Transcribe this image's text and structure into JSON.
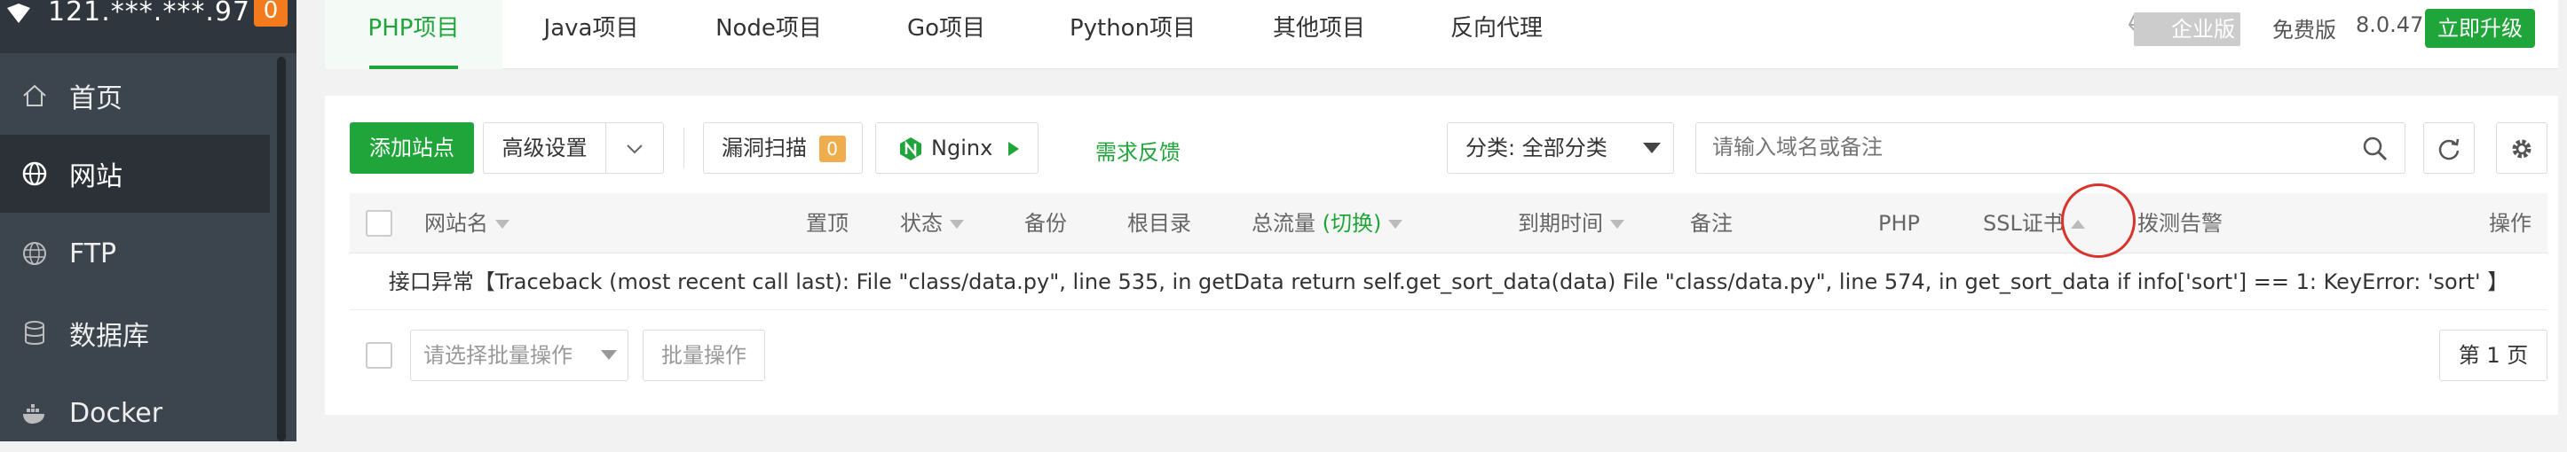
{
  "sidebar": {
    "server_ip": "121.***.***.97",
    "badge": "0",
    "items": [
      {
        "label": "首页",
        "icon": "home-icon"
      },
      {
        "label": "网站",
        "icon": "globe-icon"
      },
      {
        "label": "FTP",
        "icon": "ftp-globe-icon"
      },
      {
        "label": "数据库",
        "icon": "database-icon"
      },
      {
        "label": "Docker",
        "icon": "docker-icon"
      }
    ]
  },
  "topnav": {
    "tabs": [
      "PHP项目",
      "Java项目",
      "Node项目",
      "Go项目",
      "Python项目",
      "其他项目",
      "反向代理"
    ],
    "enterprise": "企业版",
    "edition": "免费版",
    "version": "8.0.47",
    "upgrade": "立即升级"
  },
  "toolbar": {
    "add_site": "添加站点",
    "advanced": "高级设置",
    "vuln_scan": "漏洞扫描",
    "vuln_count": "0",
    "nginx": "Nginx",
    "feedback": "需求反馈",
    "category": "分类: 全部分类",
    "search_placeholder": "请输入域名或备注"
  },
  "table": {
    "headers": {
      "site_name": "网站名",
      "pin": "置顶",
      "status": "状态",
      "backup": "备份",
      "root": "根目录",
      "traffic": "总流量",
      "traffic_switch": "(切换)",
      "expire": "到期时间",
      "remark": "备注",
      "php": "PHP",
      "ssl": "SSL证书",
      "alert": "拨测告警",
      "actions": "操作"
    },
    "error_message": "接口异常【Traceback (most recent call last): File \"class/data.py\", line 535, in getData return self.get_sort_data(data) File \"class/data.py\", line 574, in get_sort_data if info['sort'] == 1: KeyError: 'sort' 】"
  },
  "footer": {
    "batch_placeholder": "请选择批量操作",
    "batch_button": "批量操作",
    "page": "第 1 页"
  },
  "colors": {
    "accent": "#20a53a",
    "sidebar": "#3c444d",
    "highlight": "#d9342b"
  }
}
